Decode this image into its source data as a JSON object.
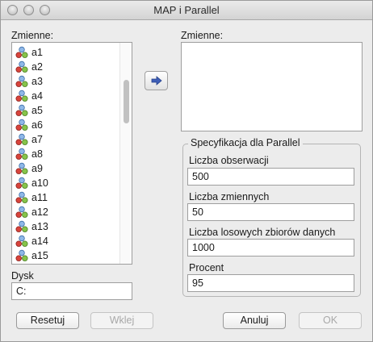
{
  "window": {
    "title": "MAP i Parallel"
  },
  "source": {
    "label": "Zmienne:",
    "items": [
      {
        "label": "a1"
      },
      {
        "label": "a2"
      },
      {
        "label": "a3"
      },
      {
        "label": "a4"
      },
      {
        "label": "a5"
      },
      {
        "label": "a6"
      },
      {
        "label": "a7"
      },
      {
        "label": "a8"
      },
      {
        "label": "a9"
      },
      {
        "label": "a10"
      },
      {
        "label": "a11"
      },
      {
        "label": "a12"
      },
      {
        "label": "a13"
      },
      {
        "label": "a14"
      },
      {
        "label": "a15"
      }
    ]
  },
  "target": {
    "label": "Zmienne:"
  },
  "spec": {
    "title": "Specyfikacja dla Parallel",
    "fields": [
      {
        "label": "Liczba obserwacji",
        "value": "500"
      },
      {
        "label": "Liczba zmiennych",
        "value": "50"
      },
      {
        "label": "Liczba losowych zbiorów danych",
        "value": "1000"
      },
      {
        "label": "Procent",
        "value": "95"
      }
    ]
  },
  "disk": {
    "label": "Dysk",
    "value": "C:"
  },
  "buttons": {
    "reset": "Resetuj",
    "paste": "Wklej",
    "cancel": "Anuluj",
    "ok": "OK"
  },
  "icons": {
    "move_right": "arrow-right-icon",
    "variable": "scale-variable-icon",
    "accent": "#3f5fb8"
  }
}
